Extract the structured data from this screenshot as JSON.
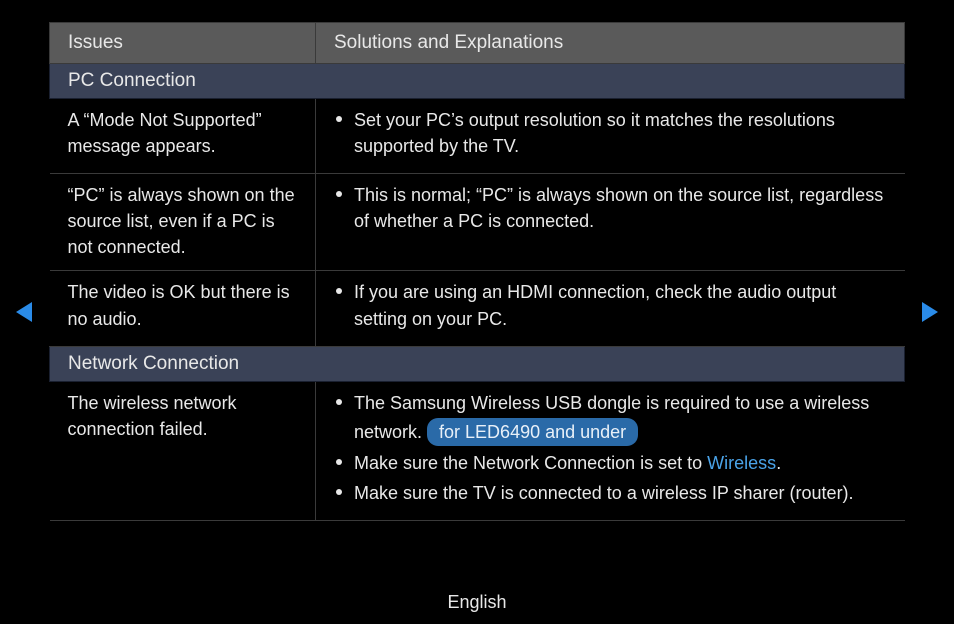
{
  "header": {
    "issues": "Issues",
    "solutions": "Solutions and Explanations"
  },
  "section1": {
    "title": "PC Connection"
  },
  "row1": {
    "issue": "A “Mode Not Supported” message appears.",
    "sol1": "Set your PC’s output resolution so it matches the resolutions supported by the TV."
  },
  "row2": {
    "issue": "“PC” is always shown on the source list, even if a PC is not connected.",
    "sol1": "This is normal; “PC” is always shown on the source list, regardless of whether a PC is connected."
  },
  "row3": {
    "issue": "The video is OK but there is no audio.",
    "sol1": "If you are using an HDMI connection, check the audio output setting on your PC."
  },
  "section2": {
    "title": "Network Connection"
  },
  "row4": {
    "issue": "The wireless network connection failed.",
    "sol1a": "The Samsung Wireless USB dongle is required to use a wireless network. ",
    "sol1_pill": "for LED6490 and under",
    "sol2a": "Make sure the Network Connection is set to ",
    "sol2_kw": "Wireless",
    "sol2b": ".",
    "sol3": "Make sure the TV is connected to a wireless IP sharer (router)."
  },
  "footer": {
    "language": "English"
  }
}
